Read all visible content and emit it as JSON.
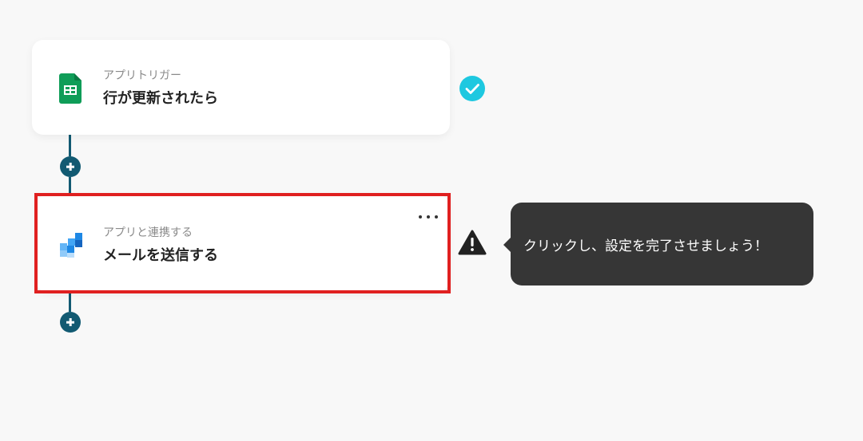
{
  "flow": {
    "steps": [
      {
        "subtitle": "アプリトリガー",
        "title": "行が更新されたら",
        "icon": "google-sheets-icon",
        "status": "completed"
      },
      {
        "subtitle": "アプリと連携する",
        "title": "メールを送信する",
        "icon": "mail-app-icon",
        "status": "warning"
      }
    ]
  },
  "tooltip": {
    "text": "クリックし、設定を完了させましょう！"
  },
  "colors": {
    "connector": "#125a72",
    "check": "#1ec8e0",
    "highlight": "#e02020",
    "tooltip_bg": "#363636",
    "sheets_green": "#0f9d58",
    "mail_blue": "#1e88e5"
  }
}
